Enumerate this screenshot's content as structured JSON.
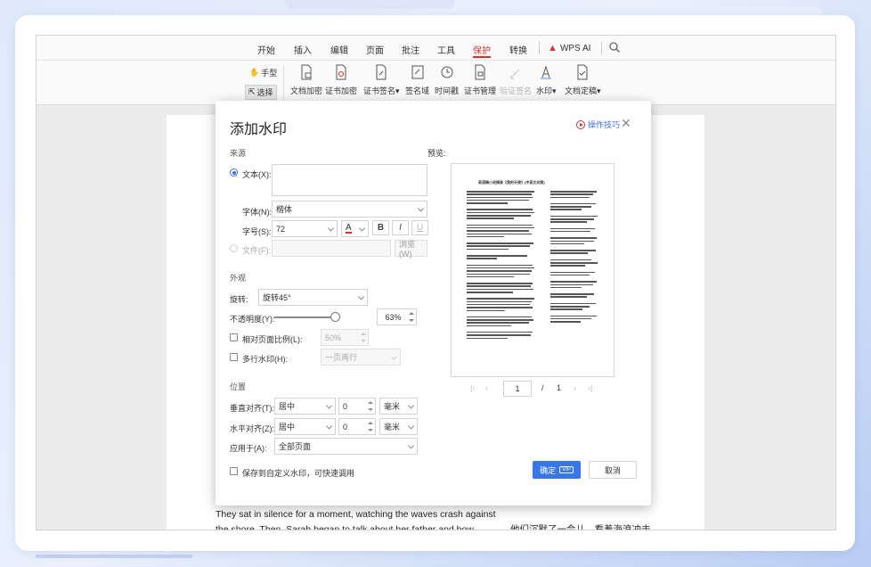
{
  "menu": {
    "items": [
      "开始",
      "插入",
      "编辑",
      "页面",
      "批注",
      "工具",
      "保护",
      "转换"
    ],
    "active": "保护",
    "ai_label": "WPS AI"
  },
  "toolbar": {
    "hand_label": "手型",
    "select_label": "选择",
    "buttons": [
      {
        "label": "文档加密",
        "icon": "doc-lock-icon"
      },
      {
        "label": "证书加密",
        "icon": "certificate-lock-icon"
      },
      {
        "label": "证书签名",
        "icon": "certificate-sign-icon",
        "dropdown": true
      },
      {
        "label": "签名域",
        "icon": "signature-field-icon"
      },
      {
        "label": "时间戳",
        "icon": "timestamp-icon"
      },
      {
        "label": "证书管理",
        "icon": "certificate-manage-icon"
      },
      {
        "label": "验证签名",
        "icon": "verify-signature-icon",
        "disabled": true
      },
      {
        "label": "水印",
        "icon": "watermark-icon",
        "dropdown": true
      },
      {
        "label": "文档定稿",
        "icon": "document-finalize-icon",
        "dropdown": true
      }
    ]
  },
  "document": {
    "english_lines": [
      "They sat in silence for a moment, watching the waves crash against",
      "the shore. Then, Sarah began to talk about her father and how much"
    ],
    "chinese_line": "他们沉默了一会儿，看着海浪冲击"
  },
  "dialog": {
    "title": "添加水印",
    "help_label": "操作技巧",
    "source_section": "来源",
    "text_radio_label": "文本(X):",
    "text_value": "",
    "font_label": "字体(N):",
    "font_value": "楷体",
    "size_label": "字号(S):",
    "size_value": "72",
    "format_buttons": [
      "B",
      "I",
      "U"
    ],
    "file_radio_label": "文件(F):",
    "browse_label": "浏览(W)",
    "appearance_section": "外观",
    "rotation_label": "旋转:",
    "rotation_value": "旋转45°",
    "opacity_label": "不透明度(Y):",
    "opacity_value": "63%",
    "opacity_fraction": 0.63,
    "relative_scale_label": "相对页面比例(L):",
    "relative_scale_value": "50%",
    "multi_line_label": "多行水印(H):",
    "multi_line_value": "一页两行",
    "position_section": "位置",
    "vertical_label": "垂直对齐(T):",
    "vertical_value": "居中",
    "vertical_offset": "0",
    "vertical_unit": "毫米",
    "horizontal_label": "水平对齐(Z):",
    "horizontal_value": "居中",
    "horizontal_offset": "0",
    "horizontal_unit": "毫米",
    "apply_label": "应用于(A):",
    "apply_value": "全部页面",
    "save_custom_label": "保存到自定义水印，可快速调用",
    "preview_label": "预览:",
    "preview_doc_title": "英语精小说摘录《我的天使》(中英文对照)",
    "page_current": "1",
    "page_sep": "/",
    "page_total": "1",
    "ok_label": "确定",
    "vip_badge": "VIP",
    "cancel_label": "取消"
  }
}
